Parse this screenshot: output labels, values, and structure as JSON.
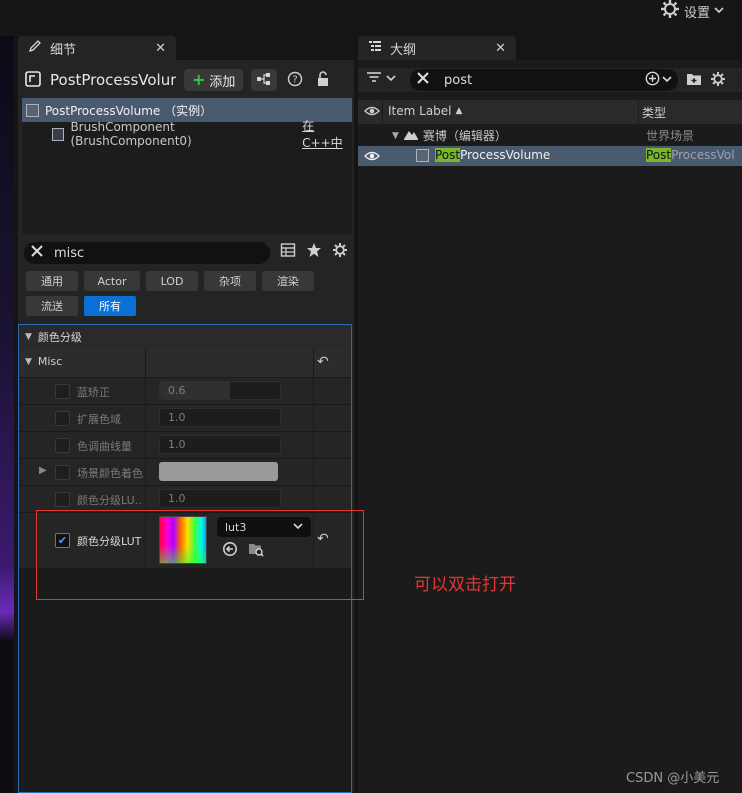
{
  "topbar": {
    "settings_label": "设置"
  },
  "details": {
    "tab_label": "细节",
    "actor_name": "PostProcessVolur",
    "add_label": "添加",
    "tree": [
      {
        "label": "PostProcessVolume （实例）"
      },
      {
        "label": "BrushComponent (BrushComponent0)",
        "extra": "在C++中"
      }
    ],
    "search": {
      "value": "misc"
    },
    "filters_row1": [
      "通用",
      "Actor",
      "LOD",
      "杂项",
      "渲染"
    ],
    "filters_row2": [
      "流送",
      "所有"
    ],
    "active_filter": "所有",
    "category": "颜色分级",
    "subcategory": "Misc",
    "properties": [
      {
        "name": "蓝矫正",
        "value": "0.6"
      },
      {
        "name": "扩展色域",
        "value": "1.0"
      },
      {
        "name": "色调曲线量",
        "value": "1.0"
      },
      {
        "name": "场景颜色着色",
        "value": ""
      },
      {
        "name": "颜色分级LU...",
        "value": "1.0"
      }
    ],
    "lut": {
      "name": "颜色分级LUT",
      "asset": "lut3",
      "checked": true
    }
  },
  "outliner": {
    "tab_label": "大纲",
    "search": {
      "value": "post"
    },
    "columns": {
      "label": "Item Label",
      "type": "类型"
    },
    "rows": [
      {
        "name": "赛博（编辑器）",
        "type": "世界场景"
      },
      {
        "name_hl": "Post",
        "name_rest": "ProcessVolume",
        "type_hl": "Post",
        "type_rest": "ProcessVol"
      }
    ]
  },
  "annotation": {
    "text": "可以双击打开"
  },
  "watermark": "CSDN @小美元",
  "colors": {
    "accent": "#0a70d6",
    "selection": "#4a5a6e",
    "highlight": "#79b829",
    "annotation": "#e53535"
  }
}
